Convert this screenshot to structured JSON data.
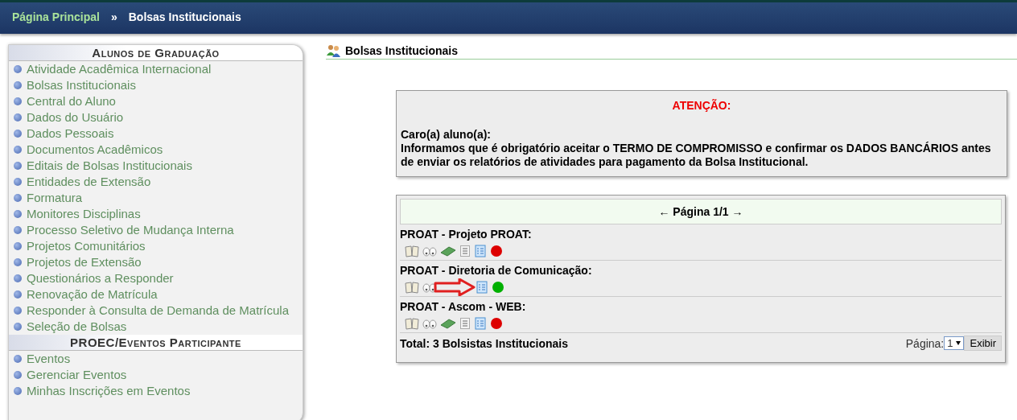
{
  "breadcrumb": {
    "home": "Página Principal",
    "separator": "»",
    "current": "Bolsas Institucionais"
  },
  "sidebar": {
    "sections": [
      {
        "title": "Alunos de Graduação",
        "items": [
          "Atividade Acadêmica Internacional",
          "Bolsas Institucionais",
          "Central do Aluno",
          "Dados do Usuário",
          "Dados Pessoais",
          "Documentos Acadêmicos",
          "Editais de Bolsas Institucionais",
          "Entidades de Extensão",
          "Formatura",
          "Monitores Disciplinas",
          "Processo Seletivo de Mudança Interna",
          "Projetos Comunitários",
          "Projetos de Extensão",
          "Questionários a Responder",
          "Renovação de Matrícula",
          "Responder à Consulta de Demanda de Matrícula",
          "Seleção de Bolsas"
        ]
      },
      {
        "title": "PROEC/Eventos Participante",
        "items": [
          "Eventos",
          "Gerenciar Eventos",
          "Minhas Inscrições em Eventos"
        ]
      }
    ]
  },
  "page_title": "Bolsas Institucionais",
  "notice": {
    "title": "ATENÇÃO:",
    "greeting": "Caro(a) aluno(a):",
    "message": "Informamos que é obrigatório aceitar o TERMO DE COMPROMISSO e confirmar os DADOS BANCÁRIOS antes de enviar os relatórios de atividades para pagamento da Bolsa Institucional."
  },
  "list": {
    "pager": "← Página 1/1 →",
    "rows": [
      {
        "title": "PROAT - Projeto PROAT:",
        "color": "#dd0000",
        "annotated": false
      },
      {
        "title": "PROAT - Diretoria de Comunicação:",
        "color": "#00b000",
        "annotated": true
      },
      {
        "title": "PROAT - Ascom - WEB:",
        "color": "#dd0000",
        "annotated": false
      }
    ],
    "total": "Total: 3 Bolsistas Institucionais",
    "page_label": "Página:",
    "page_value": "1",
    "button": "Exibir"
  }
}
